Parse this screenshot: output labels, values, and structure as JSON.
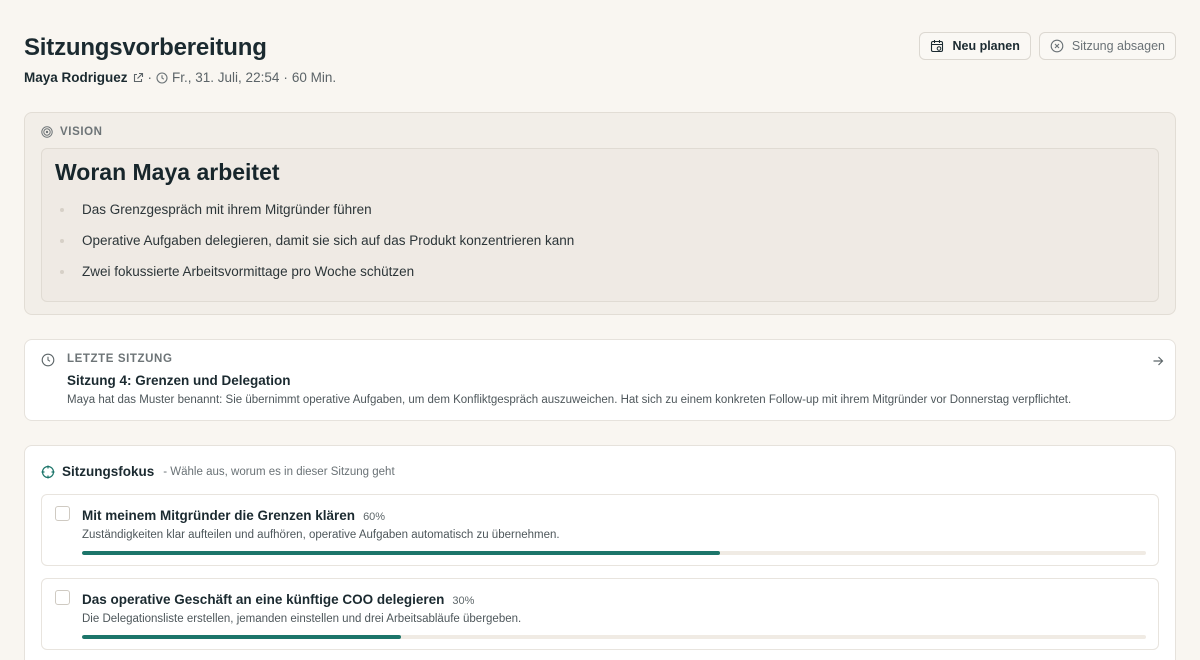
{
  "header": {
    "title": "Sitzungsvorbereitung",
    "client_name": "Maya Rodriguez",
    "separator": "·",
    "datetime": "Fr., 31. Juli, 22:54",
    "duration": "60 Min.",
    "reschedule_label": "Neu planen",
    "cancel_label": "Sitzung absagen"
  },
  "vision": {
    "label": "VISION",
    "title": "Woran Maya arbeitet",
    "items": [
      "Das Grenzgespräch mit ihrem Mitgründer führen",
      "Operative Aufgaben delegieren, damit sie sich auf das Produkt konzentrieren kann",
      "Zwei fokussierte Arbeitsvormittage pro Woche schützen"
    ]
  },
  "last_session": {
    "label": "LETZTE SITZUNG",
    "title": "Sitzung 4: Grenzen und Delegation",
    "description": "Maya hat das Muster benannt: Sie übernimmt operative Aufgaben, um dem Konfliktgespräch auszuweichen. Hat sich zu einem konkreten Follow-up mit ihrem Mitgründer vor Donnerstag verpflichtet."
  },
  "focus": {
    "title": "Sitzungsfokus",
    "hint": "- Wähle aus, worum es in dieser Sitzung geht",
    "goals": [
      {
        "title": "Mit meinem Mitgründer die Grenzen klären",
        "percent_label": "60%",
        "progress": 0.6,
        "description": "Zuständigkeiten klar aufteilen und aufhören, operative Aufgaben automatisch zu übernehmen."
      },
      {
        "title": "Das operative Geschäft an eine künftige COO delegieren",
        "percent_label": "30%",
        "progress": 0.3,
        "description": "Die Delegationsliste erstellen, jemanden einstellen und drei Arbeitsabläufe übergeben."
      }
    ]
  },
  "colors": {
    "accent": "#1c756a",
    "background": "#f9f6f1",
    "text": "#1b2a30"
  },
  "icons": {
    "external_link": "external-link-icon",
    "clock": "clock-icon",
    "calendar": "calendar-icon",
    "cancel": "x-circle-icon",
    "vision": "target-icon",
    "arrow": "arrow-right-icon",
    "focus": "crosshair-icon"
  }
}
